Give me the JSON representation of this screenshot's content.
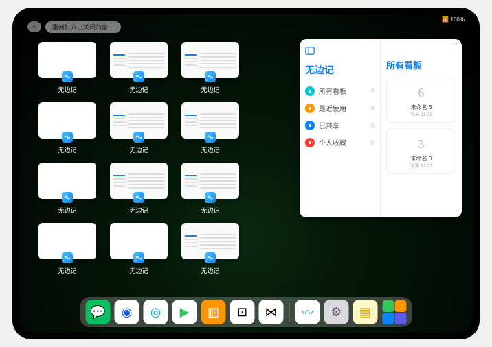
{
  "status": {
    "battery": "100%",
    "wifi": "📶"
  },
  "topbar": {
    "add": "+",
    "reopen_label": "重新打开已关闭的窗口"
  },
  "thumbs": {
    "label": "无边记",
    "items": [
      {
        "style": "blank"
      },
      {
        "style": "detail"
      },
      {
        "style": "detail"
      },
      {
        "style": "blank"
      },
      {
        "style": "detail"
      },
      {
        "style": "detail"
      },
      {
        "style": "blank"
      },
      {
        "style": "detail"
      },
      {
        "style": "detail"
      },
      {
        "style": "blank"
      },
      {
        "style": "blank"
      },
      {
        "style": "detail"
      }
    ]
  },
  "panel": {
    "title": "无边记",
    "right_title": "所有看板",
    "nav": [
      {
        "label": "所有看板",
        "count": 8,
        "color": "#00c8d7"
      },
      {
        "label": "最近使用",
        "count": 8,
        "color": "#ff9500"
      },
      {
        "label": "已共享",
        "count": 0,
        "color": "#0a84ff"
      },
      {
        "label": "个人收藏",
        "count": 0,
        "color": "#ff3b30"
      }
    ],
    "boards": [
      {
        "name": "未命名 6",
        "meta": "今天 11:28",
        "glyph": "6"
      },
      {
        "name": "未命名 3",
        "meta": "今天 11:23",
        "glyph": "3"
      }
    ]
  },
  "dock": {
    "apps": [
      {
        "name": "wechat",
        "bg": "#07c160",
        "glyph": "💬"
      },
      {
        "name": "browser1",
        "bg": "#ffffff",
        "glyph": "◉",
        "fg": "#1a5cff"
      },
      {
        "name": "browser2",
        "bg": "#ffffff",
        "glyph": "◎",
        "fg": "#06a8ff"
      },
      {
        "name": "media",
        "bg": "#ffffff",
        "glyph": "▶",
        "fg": "#34c759"
      },
      {
        "name": "books",
        "bg": "#ff9500",
        "glyph": "▥"
      },
      {
        "name": "dice",
        "bg": "#ffffff",
        "glyph": "⊡",
        "fg": "#000"
      },
      {
        "name": "connect",
        "bg": "#ffffff",
        "glyph": "⋈",
        "fg": "#000"
      }
    ],
    "recent": [
      {
        "name": "freeform",
        "bg": "#ffffff",
        "glyph": "〰",
        "fg": "#0a84ff"
      },
      {
        "name": "settings",
        "bg": "#d9d9de",
        "glyph": "⚙",
        "fg": "#555"
      },
      {
        "name": "notes",
        "bg": "#fff9c4",
        "glyph": "▤",
        "fg": "#d4a500"
      }
    ],
    "stack": [
      {
        "bg": "#34c759"
      },
      {
        "bg": "#ff9500"
      },
      {
        "bg": "#0a84ff"
      },
      {
        "bg": "#5e5ce6"
      }
    ]
  }
}
